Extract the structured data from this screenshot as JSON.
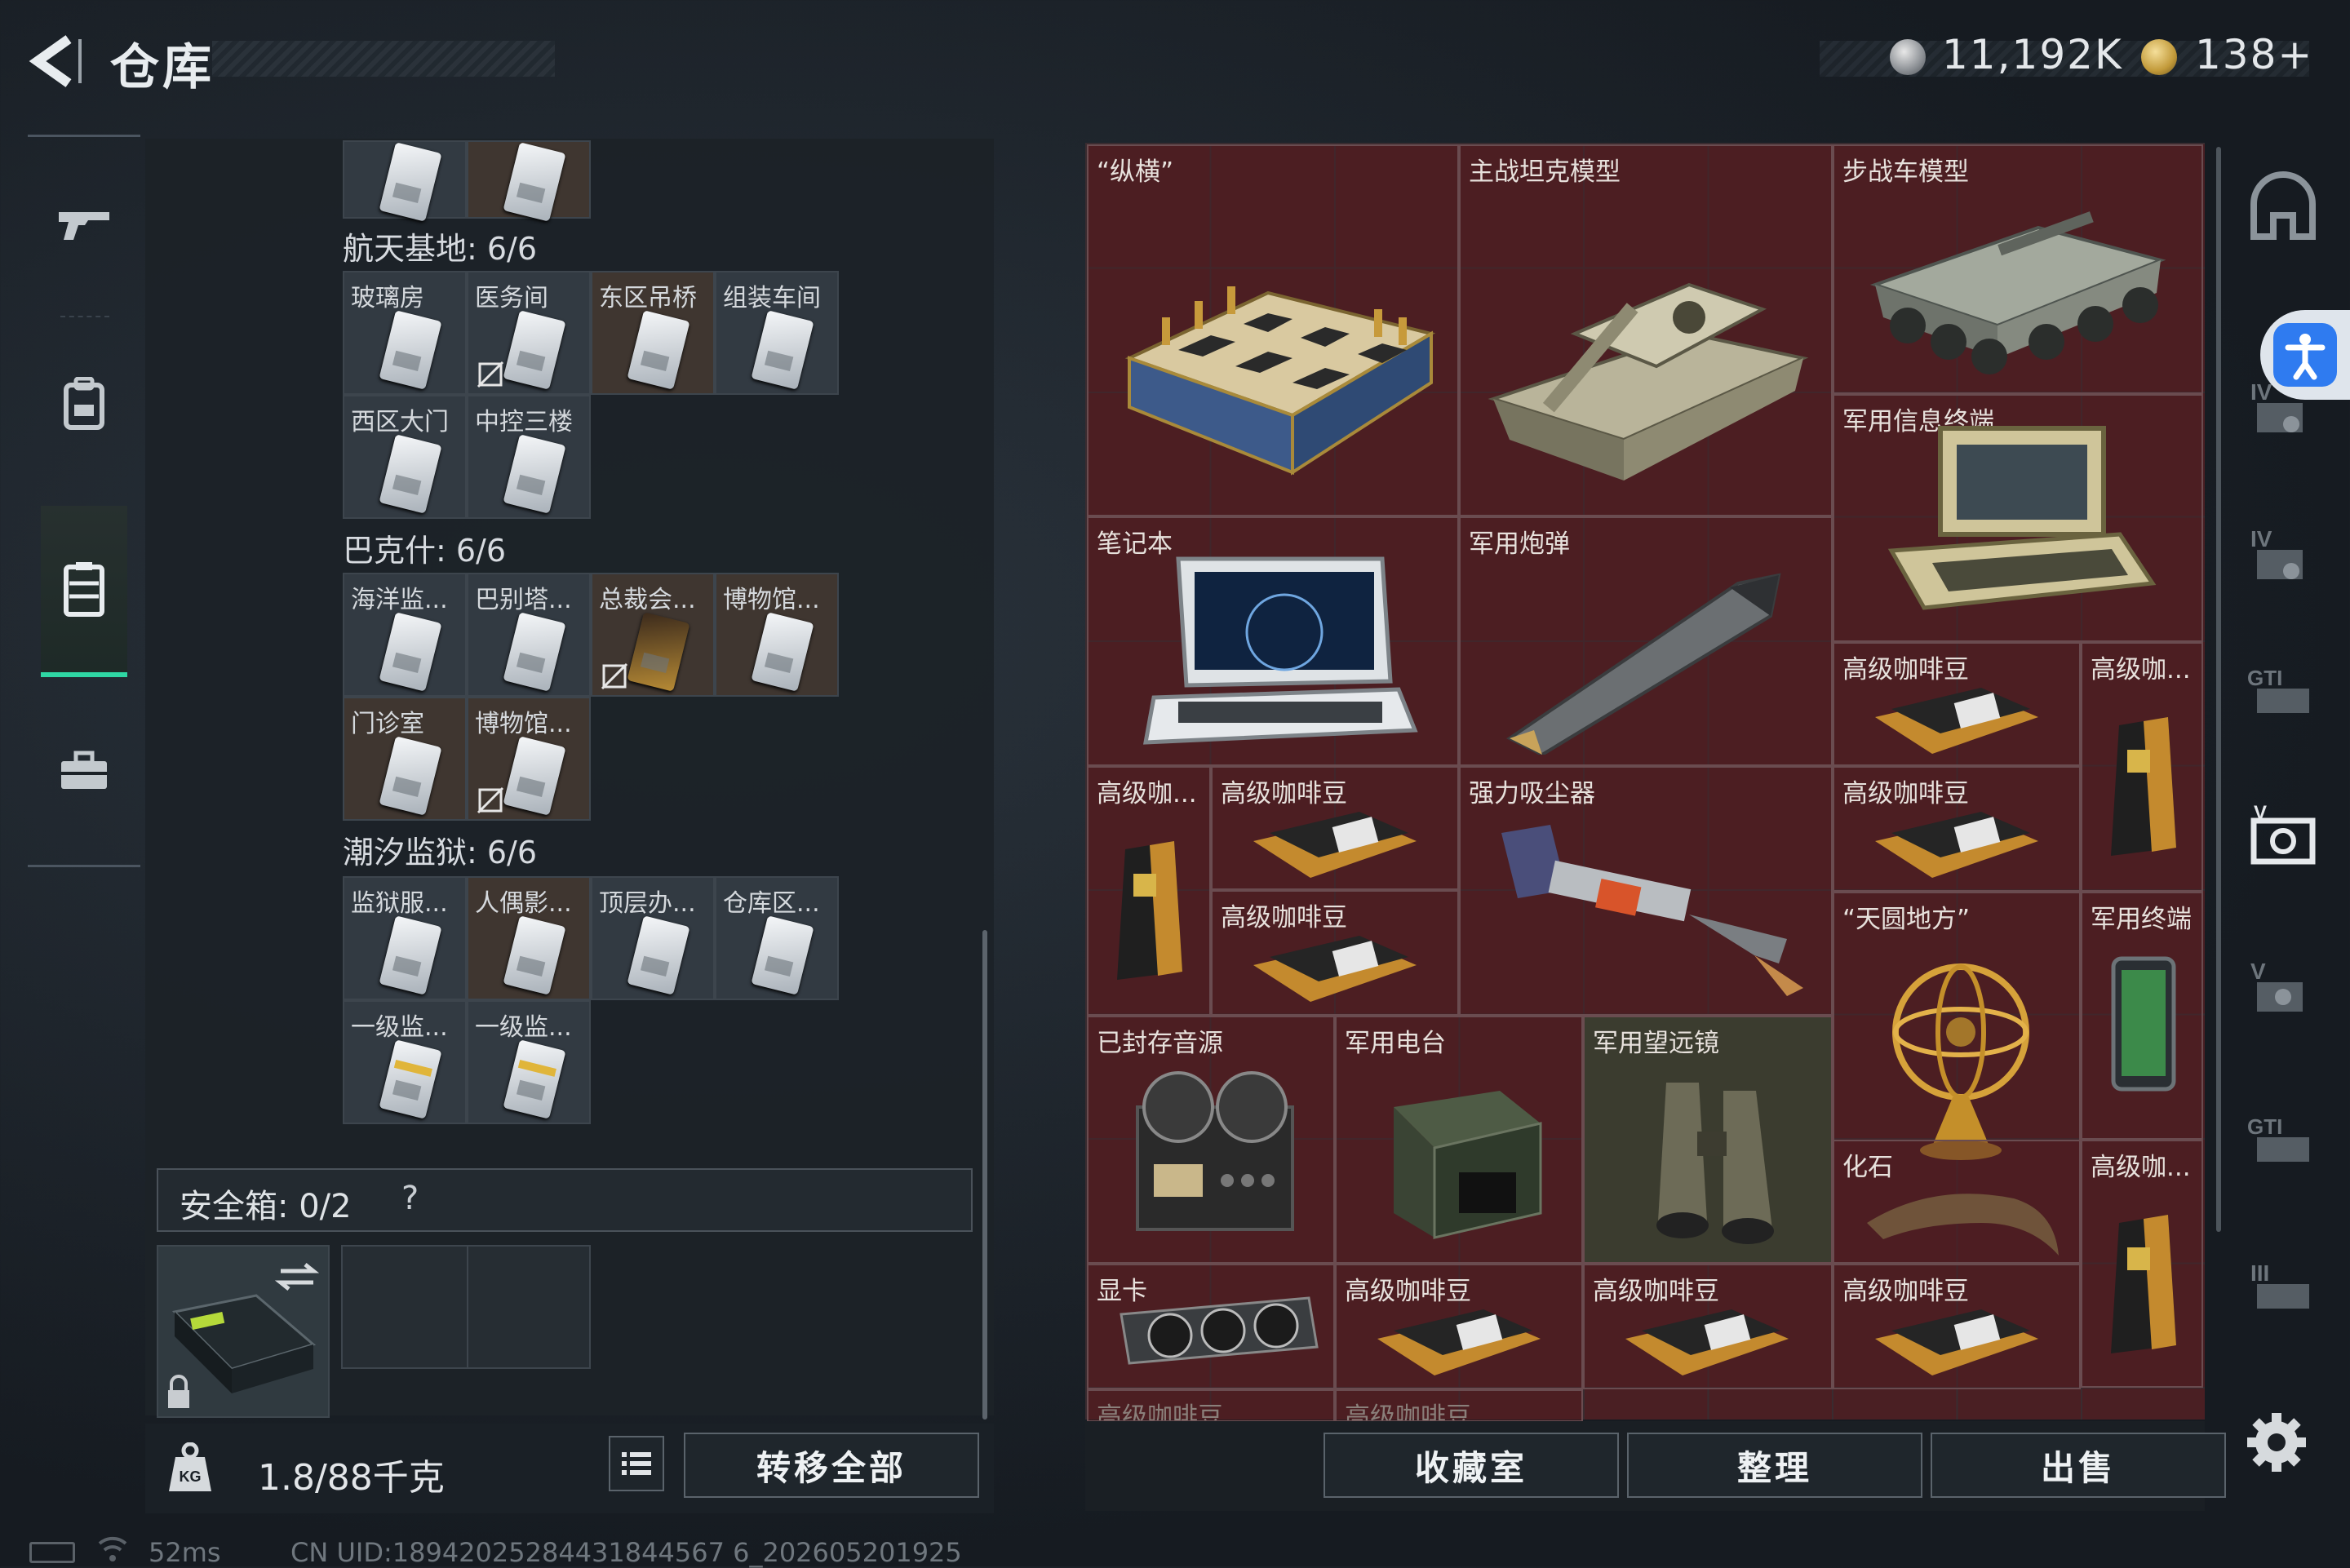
{
  "header": {
    "title": "仓库",
    "silver_amount": "11,192K",
    "gold_amount": "138+"
  },
  "left_nav": {
    "items": [
      "weapon",
      "backpack",
      "vest",
      "toolbox"
    ],
    "active": "vest"
  },
  "stash": {
    "groups": [
      {
        "name": "航天基地: 6/6",
        "slots": [
          "玻璃房",
          "医务间",
          "东区吊桥",
          "组装车间",
          "西区大门",
          "中控三楼"
        ]
      },
      {
        "name": "巴克什: 6/6",
        "slots": [
          "海洋监...",
          "巴别塔...",
          "总裁会...",
          "博物馆...",
          "门诊室",
          "博物馆..."
        ]
      },
      {
        "name": "潮汐监狱: 6/6",
        "slots": [
          "监狱服...",
          "人偶影...",
          "顶层办...",
          "仓库区...",
          "一级监...",
          "一级监..."
        ]
      }
    ],
    "safe_box_label": "安全箱: 0/2",
    "safe_box_help": "?",
    "weight": "1.8/88千克",
    "transfer_all": "转移全部"
  },
  "items": [
    {
      "label": "“纵横”",
      "icon": "chess-set-icon"
    },
    {
      "label": "主战坦克模型",
      "icon": "tank-model-icon"
    },
    {
      "label": "步战车模型",
      "icon": "ifv-model-icon"
    },
    {
      "label": "军用信息终端",
      "icon": "rugged-terminal-icon"
    },
    {
      "label": "笔记本",
      "icon": "laptop-icon"
    },
    {
      "label": "军用炮弹",
      "icon": "artillery-shell-icon"
    },
    {
      "label": "高级咖啡豆",
      "icon": "coffee-beans-icon"
    },
    {
      "label": "高级咖...",
      "icon": "coffee-bag-icon"
    },
    {
      "label": "高级咖...",
      "icon": "coffee-bag-icon"
    },
    {
      "label": "高级咖啡豆",
      "icon": "coffee-beans-icon"
    },
    {
      "label": "强力吸尘器",
      "icon": "vacuum-icon"
    },
    {
      "label": "高级咖啡豆",
      "icon": "coffee-beans-icon"
    },
    {
      "label": "高级咖啡豆",
      "icon": "coffee-beans-icon"
    },
    {
      "label": "“天圆地方”",
      "icon": "armillary-sphere-icon"
    },
    {
      "label": "军用终端",
      "icon": "tablet-icon"
    },
    {
      "label": "已封存音源",
      "icon": "reel-recorder-icon"
    },
    {
      "label": "军用电台",
      "icon": "radio-icon"
    },
    {
      "label": "军用望远镜",
      "icon": "binoculars-icon"
    },
    {
      "label": "化石",
      "icon": "fossil-claw-icon"
    },
    {
      "label": "高级咖...",
      "icon": "coffee-bag-icon"
    },
    {
      "label": "显卡",
      "icon": "gpu-icon"
    },
    {
      "label": "高级咖啡豆",
      "icon": "coffee-beans-icon"
    },
    {
      "label": "高级咖啡豆",
      "icon": "coffee-beans-icon"
    },
    {
      "label": "高级咖啡豆",
      "icon": "coffee-beans-icon"
    },
    {
      "label": "高级咖啡豆",
      "icon": "coffee-beans-icon"
    },
    {
      "label": "高级咖啡豆",
      "icon": "coffee-beans-icon"
    }
  ],
  "actions": {
    "collection": "收藏室",
    "organize": "整理",
    "sell": "出售"
  },
  "filters": [
    "shelter-icon",
    "level-iv-icon",
    "level-iv-icon",
    "gti-icon",
    "level-v-icon",
    "level-v-icon",
    "gti-icon",
    "level-iii-icon"
  ],
  "status": {
    "ping": "52ms",
    "uid": "CN UID:18942025284431844567 6_202605201925"
  },
  "colors": {
    "accent_green": "#2fd7a4",
    "item_bg": "#4a1f23",
    "panel_bg": "#1c2228"
  }
}
